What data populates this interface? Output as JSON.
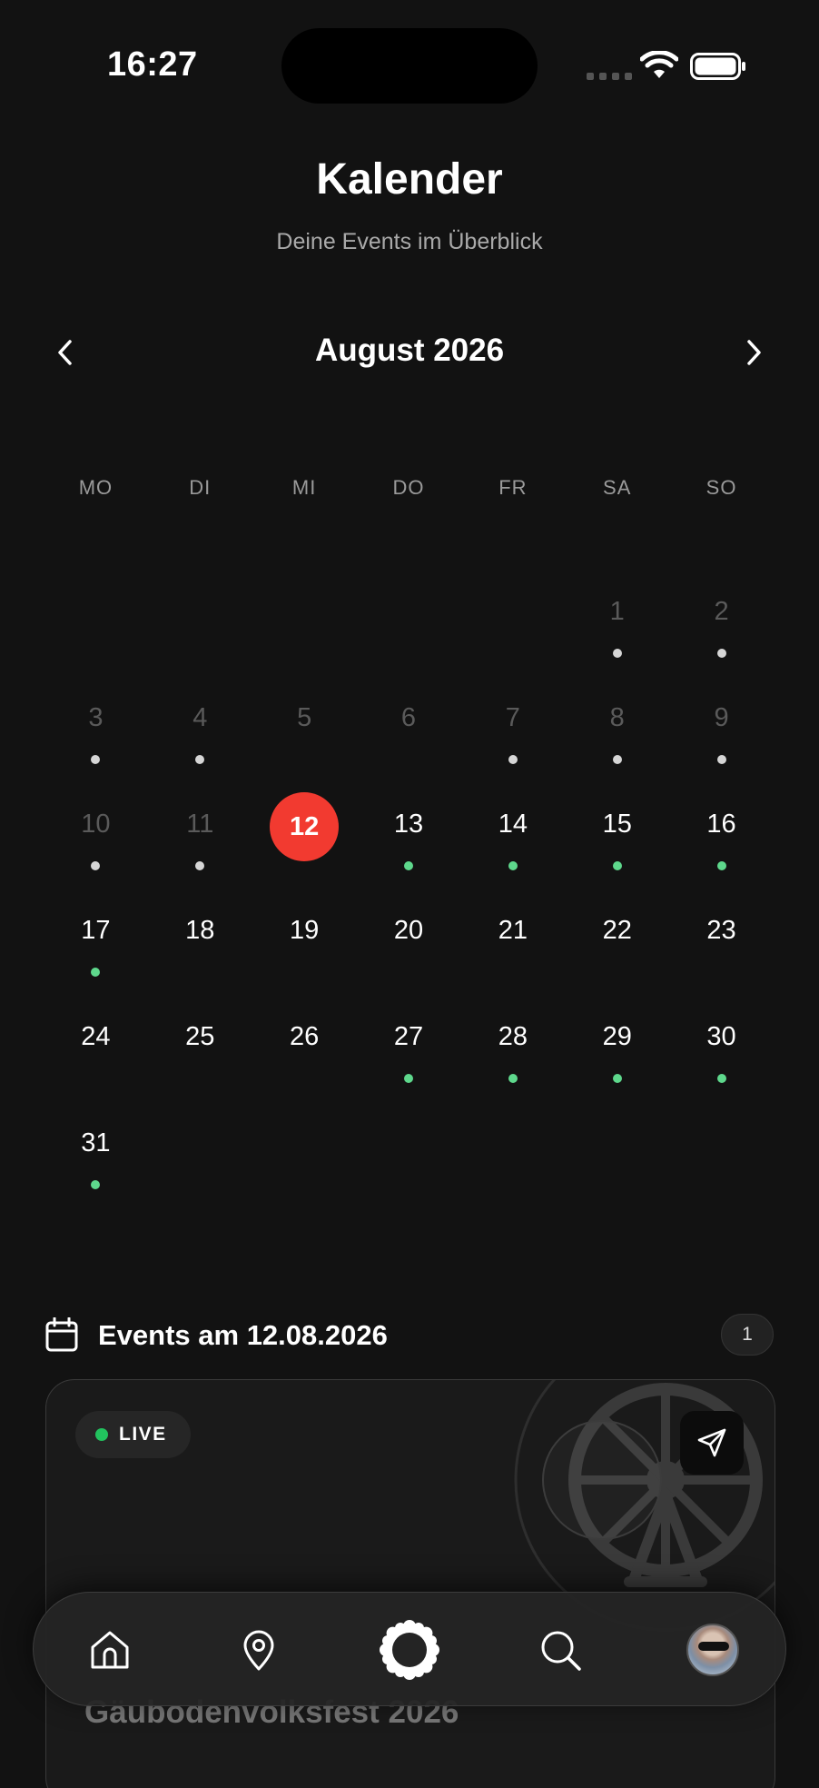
{
  "status_bar": {
    "time": "16:27"
  },
  "header": {
    "title": "Kalender",
    "subtitle": "Deine Events im Überblick"
  },
  "month_nav": {
    "label": "August 2026",
    "prev_icon": "chevron-left-icon",
    "next_icon": "chevron-right-icon"
  },
  "weekdays": [
    "MO",
    "DI",
    "MI",
    "DO",
    "FR",
    "SA",
    "SO"
  ],
  "calendar": {
    "leading_empty": 5,
    "today": 12,
    "days": [
      {
        "n": "1",
        "state": "past",
        "dot": "grey"
      },
      {
        "n": "2",
        "state": "past",
        "dot": "grey"
      },
      {
        "n": "3",
        "state": "past",
        "dot": "grey"
      },
      {
        "n": "4",
        "state": "past",
        "dot": "grey"
      },
      {
        "n": "5",
        "state": "past",
        "dot": ""
      },
      {
        "n": "6",
        "state": "past",
        "dot": ""
      },
      {
        "n": "7",
        "state": "past",
        "dot": "grey"
      },
      {
        "n": "8",
        "state": "past",
        "dot": "grey"
      },
      {
        "n": "9",
        "state": "past",
        "dot": "grey"
      },
      {
        "n": "10",
        "state": "past",
        "dot": "grey"
      },
      {
        "n": "11",
        "state": "past",
        "dot": "grey"
      },
      {
        "n": "12",
        "state": "today",
        "dot": ""
      },
      {
        "n": "13",
        "state": "future",
        "dot": "green"
      },
      {
        "n": "14",
        "state": "future",
        "dot": "green"
      },
      {
        "n": "15",
        "state": "future",
        "dot": "green"
      },
      {
        "n": "16",
        "state": "future",
        "dot": "green"
      },
      {
        "n": "17",
        "state": "future",
        "dot": "green"
      },
      {
        "n": "18",
        "state": "future",
        "dot": ""
      },
      {
        "n": "19",
        "state": "future",
        "dot": ""
      },
      {
        "n": "20",
        "state": "future",
        "dot": ""
      },
      {
        "n": "21",
        "state": "future",
        "dot": ""
      },
      {
        "n": "22",
        "state": "future",
        "dot": ""
      },
      {
        "n": "23",
        "state": "future",
        "dot": ""
      },
      {
        "n": "24",
        "state": "future",
        "dot": ""
      },
      {
        "n": "25",
        "state": "future",
        "dot": ""
      },
      {
        "n": "26",
        "state": "future",
        "dot": ""
      },
      {
        "n": "27",
        "state": "future",
        "dot": "green"
      },
      {
        "n": "28",
        "state": "future",
        "dot": "green"
      },
      {
        "n": "29",
        "state": "future",
        "dot": "green"
      },
      {
        "n": "30",
        "state": "future",
        "dot": "green"
      },
      {
        "n": "31",
        "state": "future",
        "dot": "green"
      }
    ]
  },
  "colors": {
    "today": "#f23a30",
    "dot_past": "#d6d6d6",
    "dot_event": "#5ed88c",
    "live": "#22c25e",
    "background": "#121212"
  },
  "events_section": {
    "title": "Events am 12.08.2026",
    "count": "1",
    "icon": "calendar-icon"
  },
  "event_card": {
    "badge": "LIVE",
    "name": "Gäubodenvolksfest 2026",
    "share_icon": "send-icon",
    "image_icon": "ferris-wheel-icon"
  },
  "bottom_nav": {
    "items": [
      "home-icon",
      "map-pin-icon",
      "center-badge-icon",
      "search-icon",
      "avatar"
    ]
  }
}
